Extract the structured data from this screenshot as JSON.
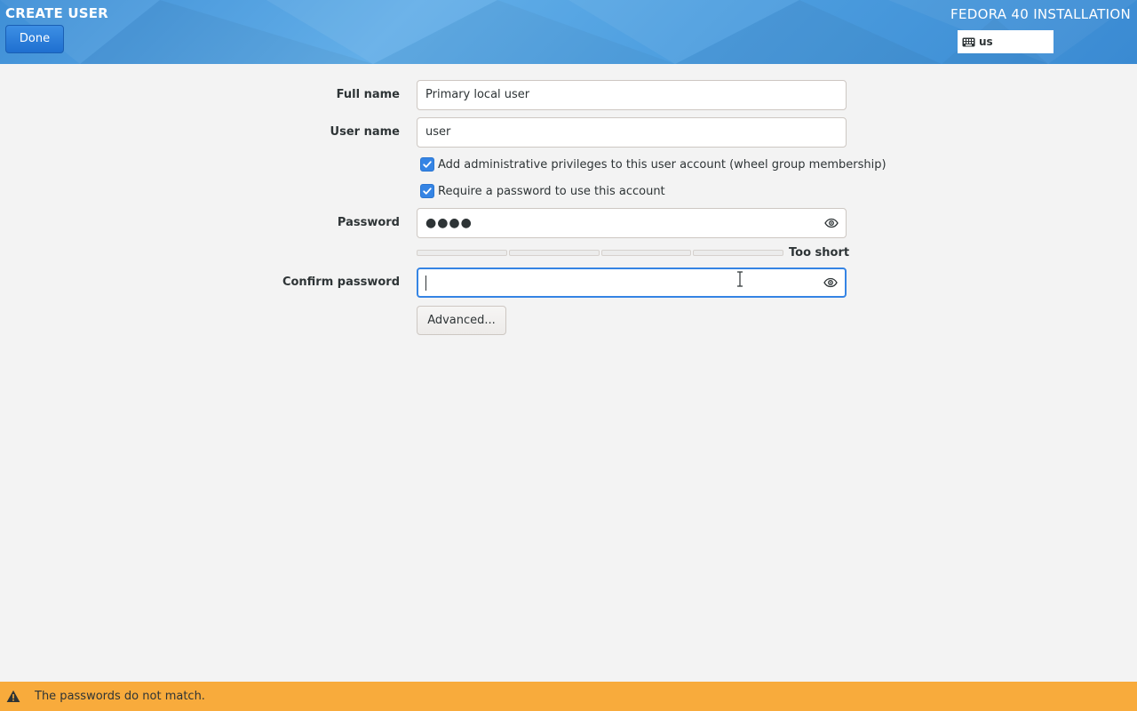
{
  "header": {
    "title": "CREATE USER",
    "done_label": "Done",
    "product": "FEDORA 40 INSTALLATION",
    "keyboard_layout": "us"
  },
  "form": {
    "fullname_label": "Full name",
    "fullname_value": "Primary local user",
    "username_label": "User name",
    "username_value": "user",
    "admin_checkbox_label": "Add administrative privileges to this user account (wheel group membership)",
    "admin_checked": true,
    "require_password_label": "Require a password to use this account",
    "require_password_checked": true,
    "password_label": "Password",
    "password_value": "●●●●",
    "strength_label": "Too short",
    "strength_level": 0,
    "confirm_label": "Confirm password",
    "confirm_value": "",
    "advanced_label": "Advanced..."
  },
  "status": {
    "message": "The passwords do not match.",
    "color": "#f8ab3c"
  },
  "icons": {
    "keyboard": "keyboard-icon",
    "eye": "eye-icon",
    "warning": "warning-icon"
  },
  "colors": {
    "accent": "#3584e4",
    "header": "#4e9fe0"
  }
}
